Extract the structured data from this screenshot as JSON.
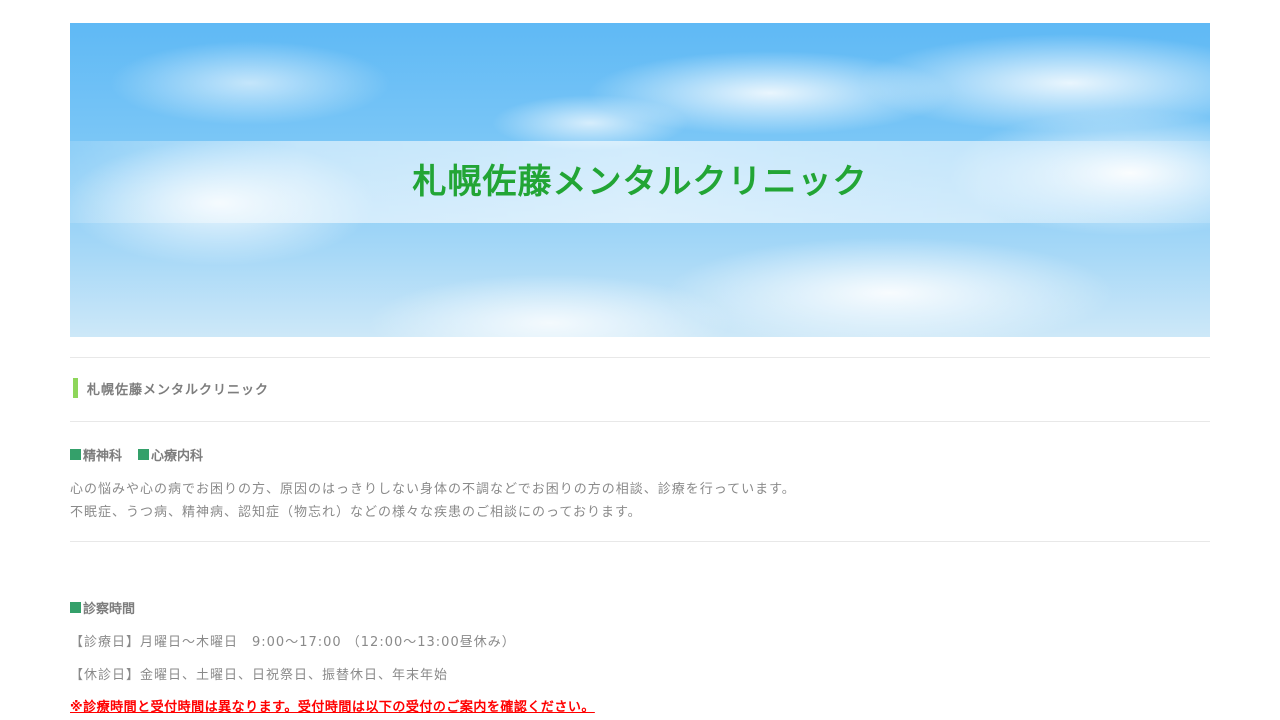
{
  "hero": {
    "title": "札幌佐藤メンタルクリニック"
  },
  "section": {
    "heading": "札幌佐藤メンタルクリニック"
  },
  "departments": {
    "items": [
      "精神科",
      "心療内科"
    ]
  },
  "intro": {
    "line1": "心の悩みや心の病でお困りの方、原因のはっきりしない身体の不調などでお困りの方の相談、診療を行っています。",
    "line2": "不眠症、うつ病、精神病、認知症（物忘れ）などの様々な疾患のご相談にのっております。"
  },
  "hours": {
    "heading": "診察時間",
    "open_days": "【診療日】月曜日～木曜日　9:00～17:00 （12:00～13:00昼休み）",
    "closed_days": "【休診日】金曜日、土曜日、日祝祭日、振替休日、年末年始",
    "notice": "※診療時間と受付時間は異なります。受付時間は以下の受付のご案内を確認ください。"
  },
  "colors": {
    "title_green": "#22a535",
    "accent_bar": "#8ed65a",
    "square_bullet": "#34a06a",
    "notice_red": "#ff0000"
  }
}
